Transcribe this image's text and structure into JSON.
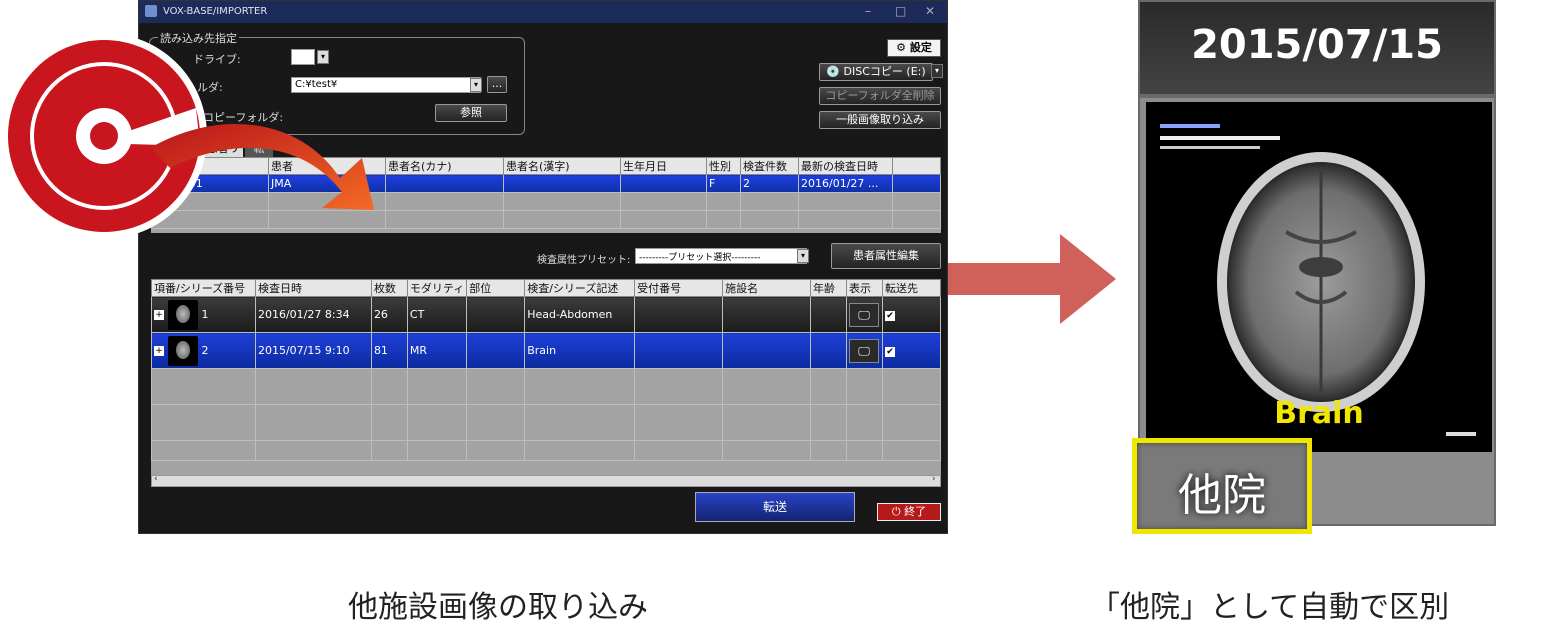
{
  "window": {
    "title": "VOX-BASE/IMPORTER",
    "settings_label": "設定",
    "disc_copy_label": "DISCコピー (E:)",
    "delete_copy_label": "コピーフォルダ全削除",
    "general_import_label": "一般画像取り込み"
  },
  "source": {
    "group_label": "読み込み先指定",
    "drive_label": "ドライブ:",
    "folder_label": "ルダ:",
    "folder_value": "C:¥test¥",
    "browse_small": "...",
    "copy_folder_label": "コピーフォルダ:",
    "browse_label": "参照"
  },
  "tabs": [
    "患者リスト",
    "転"
  ],
  "patient_table": {
    "headers": [
      "",
      "患者",
      "患者名(カナ)",
      "患者名(漢字)",
      "生年月日",
      "性別",
      "検査件数",
      "最新の検査日時"
    ],
    "rows": [
      [
        "JMAC101",
        "JMA",
        "",
        "",
        "",
        "F",
        "2",
        "2016/01/27 ..."
      ]
    ]
  },
  "preset": {
    "label": "検査属性プリセット:",
    "value": "---------プリセット選択---------",
    "edit_label": "患者属性編集"
  },
  "series_table": {
    "headers": [
      "項番/シリーズ番号",
      "検査日時",
      "枚数",
      "モダリティ",
      "部位",
      "検査/シリーズ記述",
      "受付番号",
      "施設名",
      "年齢",
      "表示",
      "転送先"
    ],
    "rows": [
      [
        "1",
        "2016/01/27 8:34",
        "26",
        "CT",
        "",
        "Head-Abdomen",
        "",
        "",
        ""
      ],
      [
        "2",
        "2015/07/15 9:10",
        "81",
        "MR",
        "",
        "Brain",
        "",
        "",
        ""
      ]
    ]
  },
  "transfer_label": "転送",
  "exit_label": "終了",
  "preview": {
    "date": "2015/07/15",
    "series": "Brain",
    "facility_tag": "他院"
  },
  "captions": {
    "left": "他施設画像の取り込み",
    "right": "「他院」として自動で区別"
  },
  "colors": {
    "arrow": "#d0605a",
    "disc": "#c8151e",
    "highlight": "#f2e600"
  }
}
